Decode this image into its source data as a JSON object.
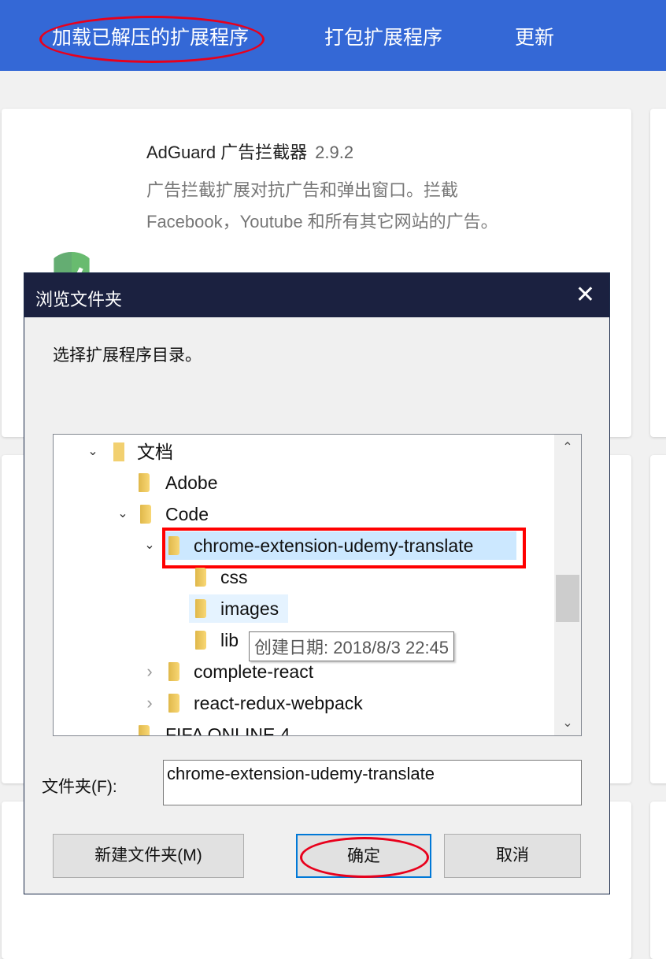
{
  "toolbar": {
    "load_unpacked": "加载已解压的扩展程序",
    "pack": "打包扩展程序",
    "update": "更新"
  },
  "extension": {
    "name": "AdGuard 广告拦截器",
    "version": "2.9.2",
    "description": "广告拦截扩展对抗广告和弹出窗口。拦截 Facebook，Youtube 和所有其它网站的广告。",
    "icon": "shield-check-icon",
    "icon_color": "#68b36b"
  },
  "dialog": {
    "title": "浏览文件夹",
    "prompt": "选择扩展程序目录。",
    "tree": [
      {
        "label": "文档",
        "expanded": true
      },
      {
        "label": "Adobe"
      },
      {
        "label": "Code",
        "expanded": true
      },
      {
        "label": "chrome-extension-udemy-translate",
        "expanded": true,
        "selected": true
      },
      {
        "label": "css"
      },
      {
        "label": "images"
      },
      {
        "label": "lib"
      },
      {
        "label": "complete-react",
        "expanded": false
      },
      {
        "label": "react-redux-webpack",
        "expanded": false
      },
      {
        "label": "FIFA ONLINE 4"
      }
    ],
    "tooltip": "创建日期: 2018/8/3 22:45",
    "folder_label": "文件夹(F):",
    "folder_value": "chrome-extension-udemy-translate",
    "new_folder": "新建文件夹(M)",
    "ok": "确定",
    "cancel": "取消"
  },
  "colors": {
    "topbar": "#3468d6",
    "highlight": "#e8001c",
    "selection": "#cce8ff"
  }
}
